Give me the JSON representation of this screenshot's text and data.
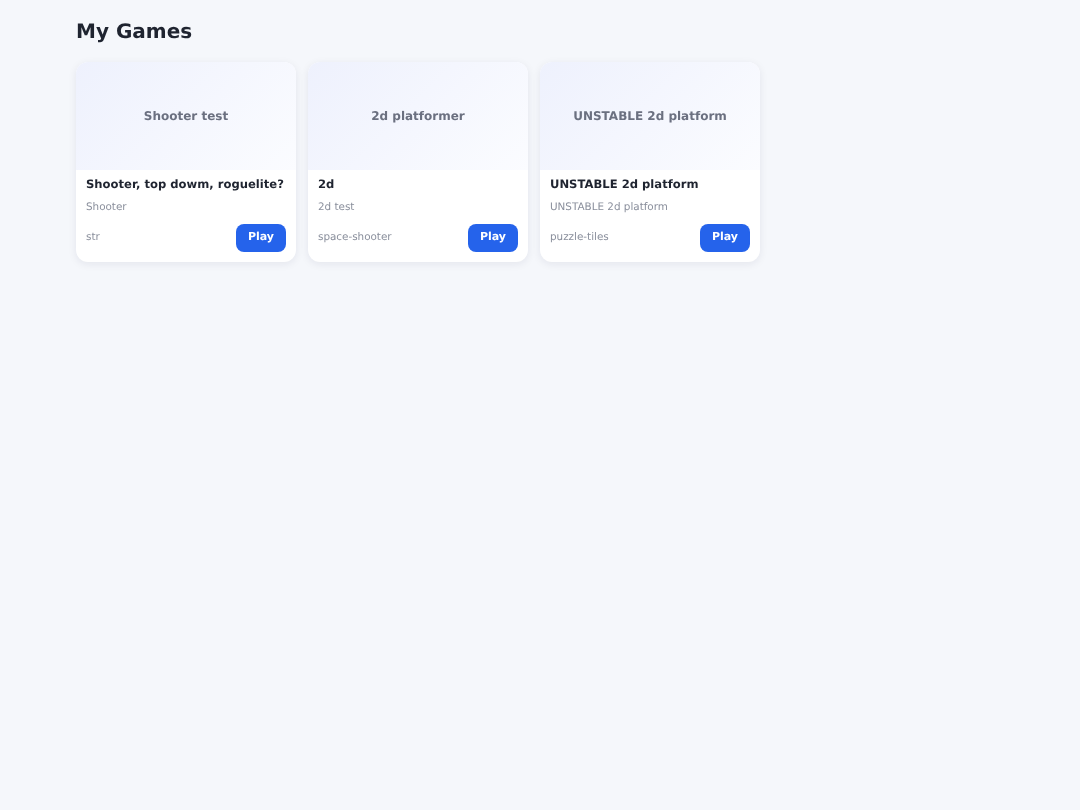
{
  "heading": "My Games",
  "games": [
    {
      "thumbnail": "Shooter test",
      "title": "Shooter, top dowm, roguelite?",
      "description": "Shooter",
      "tag": "str",
      "button": "Play"
    },
    {
      "thumbnail": "2d platformer",
      "title": "2d",
      "description": "2d test",
      "tag": "space-shooter",
      "button": "Play"
    },
    {
      "thumbnail": "UNSTABLE 2d platform",
      "title": "UNSTABLE 2d platform",
      "description": "UNSTABLE 2d platform",
      "tag": "puzzle-tiles",
      "button": "Play"
    }
  ]
}
